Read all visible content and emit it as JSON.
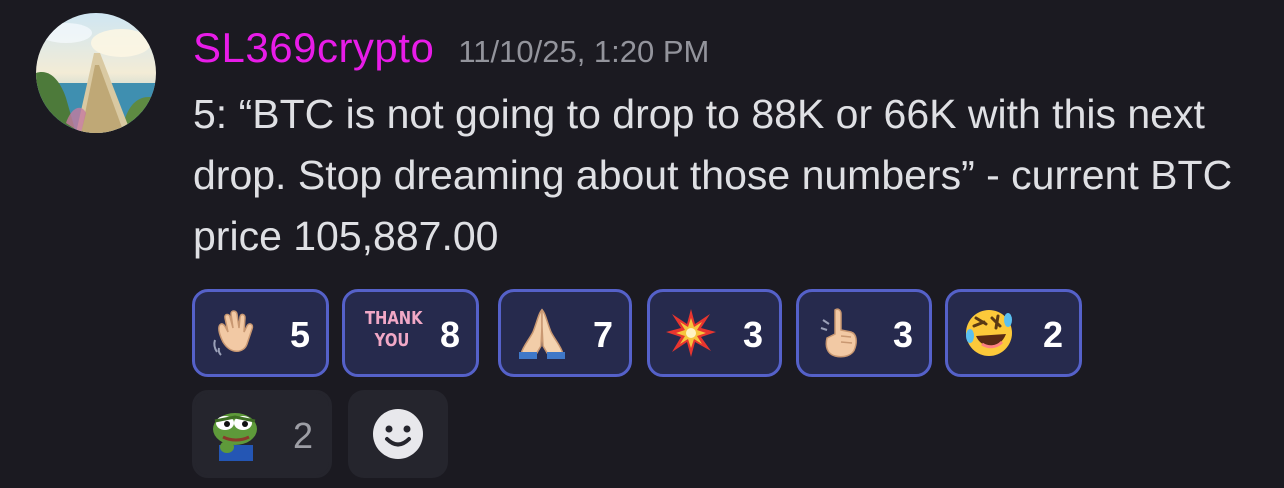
{
  "message": {
    "username": "SL369crypto",
    "timestamp": "11/10/25, 1:20 PM",
    "text": "5: “BTC is not going to drop to 88K or 66K with this next drop. Stop dreaming about those numbers” - current BTC price 105,887.00",
    "username_color": "#e81ce8"
  },
  "reactions": [
    {
      "icon": "waving-hand-icon",
      "count": "5",
      "selected": true
    },
    {
      "icon": "thank-you-sticker-icon",
      "label_line1": "THANK",
      "label_line2": "YOU",
      "count": "8",
      "selected": true
    },
    {
      "icon": "folded-hands-icon",
      "count": "7",
      "selected": true
    },
    {
      "icon": "collision-icon",
      "count": "3",
      "selected": true
    },
    {
      "icon": "pointing-up-icon",
      "count": "3",
      "selected": true
    },
    {
      "icon": "rolling-laughing-face-icon",
      "count": "2",
      "selected": true
    },
    {
      "icon": "pepe-frog-icon",
      "count": "2",
      "selected": false
    }
  ],
  "add_reaction": {
    "icon": "smiley-add-reaction-icon"
  },
  "colors": {
    "background": "#1b1a21",
    "reaction_selected_bg": "#262a4d",
    "reaction_selected_border": "#5561c9",
    "reaction_bg": "#25252d"
  }
}
